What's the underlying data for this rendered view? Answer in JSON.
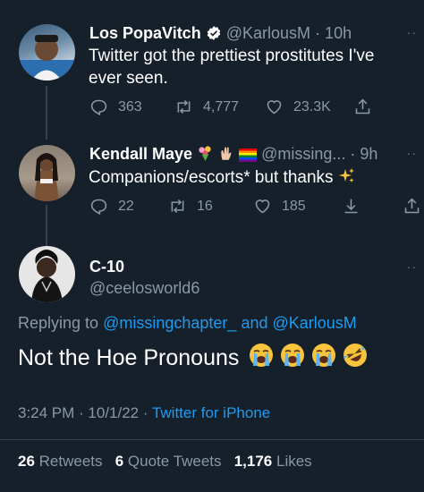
{
  "tweet1": {
    "name": "Los PopaVitch",
    "handle": "@KarlousM",
    "time": "· 10h",
    "text_line1": "Twitter got the prettiest prostitutes I've",
    "text_line2": "ever seen.",
    "replies": "363",
    "retweets": "4,777",
    "likes": "23.3K"
  },
  "tweet2": {
    "name": "Kendall Maye",
    "handle": "@missing...",
    "time": "· 9h",
    "text": "Companions/escorts* but thanks",
    "replies": "22",
    "retweets": "16",
    "likes": "185"
  },
  "main": {
    "name": "C-10",
    "handle": "@ceelosworld6",
    "replying_prefix": "Replying to",
    "replying_user1": "@missingchapter_",
    "replying_and": "and",
    "replying_user2": "@KarlousM",
    "text": "Not the Hoe Pronouns",
    "timestamp": "3:24 PM · 10/1/22 ·",
    "source": "Twitter for iPhone",
    "retweets_count": "26",
    "retweets_label": "Retweets",
    "quotes_count": "6",
    "quotes_label": "Quote Tweets",
    "likes_count": "1,176",
    "likes_label": "Likes"
  },
  "icons": {
    "verified": "verified-badge-icon",
    "reply": "reply-icon",
    "retweet": "retweet-icon",
    "like": "heart-icon",
    "share": "share-icon",
    "download": "download-icon",
    "more": "more-dots-icon"
  },
  "colors": {
    "background": "#15202b",
    "accent": "#1d9bf0",
    "muted": "#8b98a5",
    "divider": "#38444d"
  }
}
